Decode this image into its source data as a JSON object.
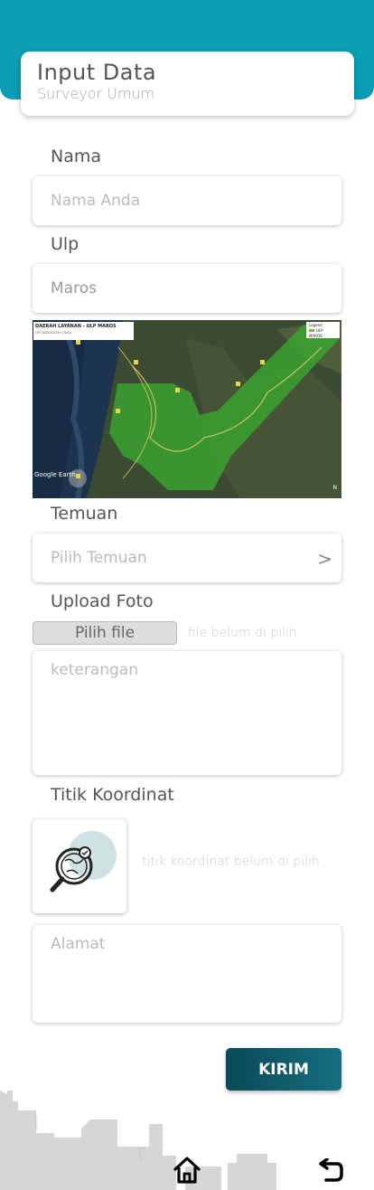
{
  "header": {
    "title": "Input Data",
    "subtitle": "Surveyor Umum"
  },
  "form": {
    "nama": {
      "label": "Nama",
      "placeholder": "Nama Anda"
    },
    "ulp": {
      "label": "Ulp",
      "value": "Maros"
    },
    "map": {
      "title": "DAERAH LAYANAN - ULP MAROS",
      "subtitle": "UP3 MAKASSAR UTARA",
      "legend_title": "Legend",
      "legend_item": "ULP MAROS",
      "credit": "Google Earth",
      "north": "N"
    },
    "temuan": {
      "label": "Temuan",
      "placeholder": "Pilih Temuan",
      "chevron": ">"
    },
    "upload": {
      "label": "Upload Foto",
      "button": "Pilih file",
      "status": "file belum di pilih"
    },
    "keterangan": {
      "placeholder": "keterangan"
    },
    "koordinat": {
      "label": "Titik Koordinat",
      "status": "titik koordinat belum di pilih"
    },
    "alamat": {
      "placeholder": "Alamat"
    },
    "submit": "KIRIM"
  },
  "colors": {
    "accent": "#0a9db3",
    "button": "#0b4957",
    "map_area": "#6ec23a"
  },
  "icons": [
    "map-search-icon",
    "home-icon",
    "back-arrow-icon"
  ]
}
